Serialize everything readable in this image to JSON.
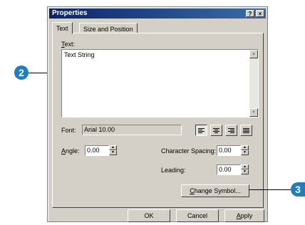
{
  "dialog": {
    "title": "Properties",
    "help_button": "?",
    "close_button": "×"
  },
  "tabs": [
    {
      "label": "Text",
      "selected": true
    },
    {
      "label": "Size and Position",
      "selected": false
    }
  ],
  "text_section": {
    "label_prefix": "",
    "label_key": "T",
    "label_rest": "ext:",
    "value": "Text String"
  },
  "font": {
    "label": "Font:",
    "value": "Arial 10.00"
  },
  "alignment": {
    "options": [
      "left",
      "center",
      "right",
      "full"
    ],
    "selected": "left"
  },
  "angle": {
    "label_key": "A",
    "label_rest": "ngle:",
    "value": "0.00"
  },
  "character_spacing": {
    "label": "Character Spacing:",
    "value": "0.00"
  },
  "leading": {
    "label": "Leading:",
    "value": "0.00"
  },
  "change_symbol": {
    "label_key": "C",
    "label_rest": "hange Symbol..."
  },
  "footer": {
    "ok": "OK",
    "cancel": "Cancel",
    "apply_key": "A",
    "apply_rest": "pply"
  },
  "callouts": [
    "2",
    "3"
  ]
}
